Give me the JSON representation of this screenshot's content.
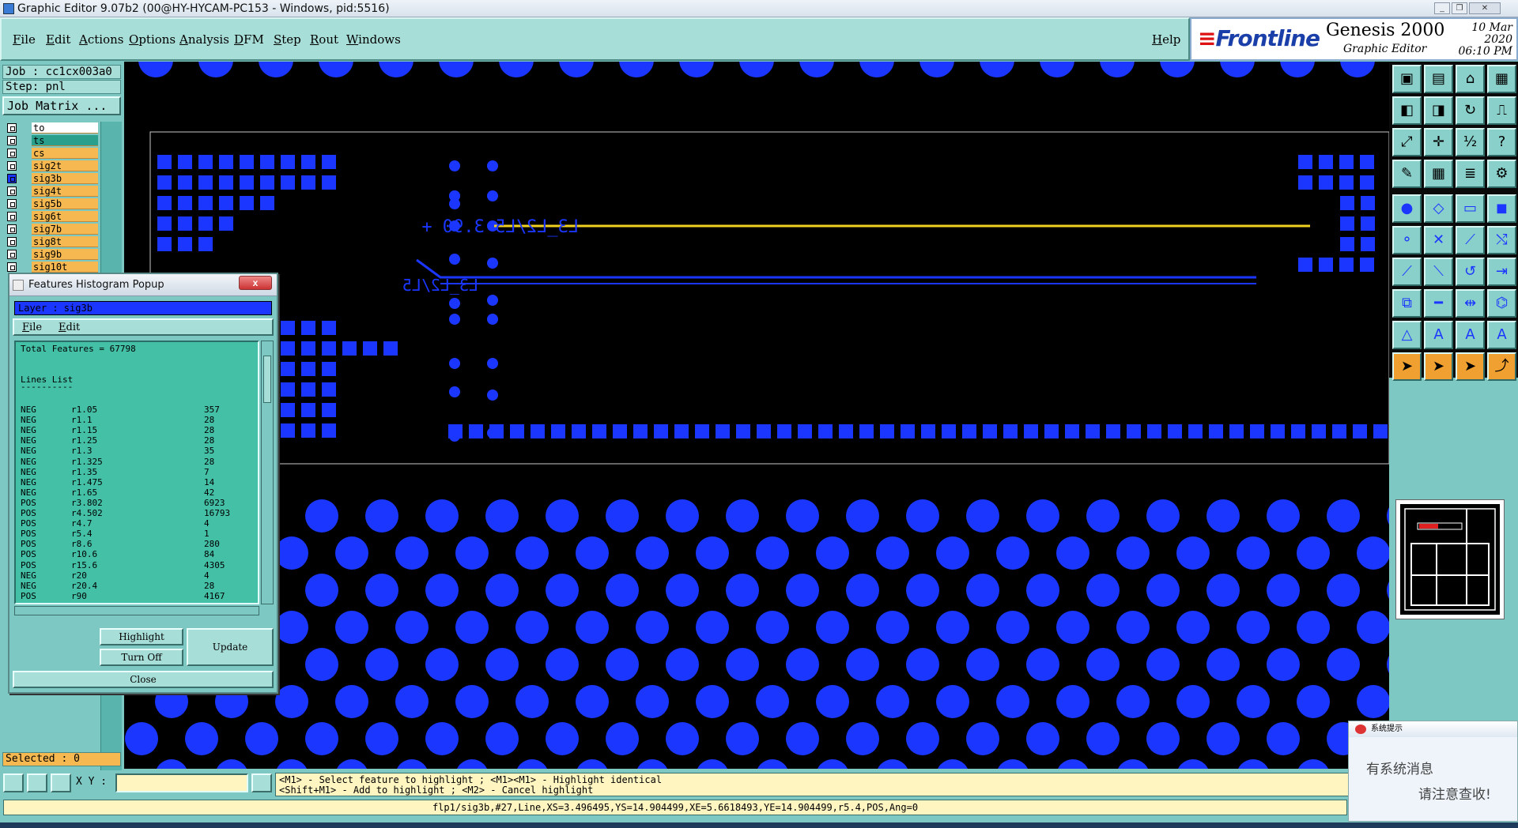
{
  "window": {
    "title": "Graphic Editor 9.07b2 (00@HY-HYCAM-PC153 - Windows, pid:5516)",
    "minimize": "_",
    "restore": "❐",
    "close": "✕"
  },
  "menu": {
    "items": [
      "File",
      "Edit",
      "Actions",
      "Options",
      "Analysis",
      "DFM",
      "Step",
      "Rout",
      "Windows"
    ],
    "help": "Help"
  },
  "brand": {
    "logo": "Frontline",
    "product": "Genesis 2000",
    "subtitle": "Graphic Editor",
    "date": "10 Mar 2020",
    "time": "06:10 PM"
  },
  "left": {
    "job": "Job : cc1cx003a0",
    "step": "Step: pnl",
    "job_matrix": "Job Matrix ...",
    "layers": [
      {
        "name": "to",
        "style": "white"
      },
      {
        "name": "ts",
        "style": "selected"
      },
      {
        "name": "cs",
        "style": "normal"
      },
      {
        "name": "sig2t",
        "style": "normal"
      },
      {
        "name": "sig3b",
        "style": "active"
      },
      {
        "name": "sig4t",
        "style": "normal"
      },
      {
        "name": "sig5b",
        "style": "normal"
      },
      {
        "name": "sig6t",
        "style": "normal"
      },
      {
        "name": "sig7b",
        "style": "normal"
      },
      {
        "name": "sig8t",
        "style": "normal"
      },
      {
        "name": "sig9b",
        "style": "normal"
      },
      {
        "name": "sig10t",
        "style": "normal"
      }
    ],
    "selected": "Selected : 0"
  },
  "canvas": {
    "label_top": "L3_L2/L5 3.90 +",
    "label_mid": "L3_L2/L5",
    "colors": {
      "background": "#000000",
      "pad": "#1a36ff",
      "trace_highlight": "#f0d020",
      "outline": "#c8c8c8"
    }
  },
  "popup": {
    "title": "Features Histogram Popup",
    "close": "x",
    "layer": "Layer :  sig3b",
    "menu": [
      "File",
      "Edit"
    ],
    "total": "Total Features = 67798",
    "section": "Lines List",
    "divider": "----------",
    "rows": [
      {
        "pol": "NEG",
        "sym": "r1.05",
        "count": "357"
      },
      {
        "pol": "NEG",
        "sym": "r1.1",
        "count": "28"
      },
      {
        "pol": "NEG",
        "sym": "r1.15",
        "count": "28"
      },
      {
        "pol": "NEG",
        "sym": "r1.25",
        "count": "28"
      },
      {
        "pol": "NEG",
        "sym": "r1.3",
        "count": "35"
      },
      {
        "pol": "NEG",
        "sym": "r1.325",
        "count": "28"
      },
      {
        "pol": "NEG",
        "sym": "r1.35",
        "count": "7"
      },
      {
        "pol": "NEG",
        "sym": "r1.475",
        "count": "14"
      },
      {
        "pol": "NEG",
        "sym": "r1.65",
        "count": "42"
      },
      {
        "pol": "POS",
        "sym": "r3.802",
        "count": "6923"
      },
      {
        "pol": "POS",
        "sym": "r4.502",
        "count": "16793"
      },
      {
        "pol": "POS",
        "sym": "r4.7",
        "count": "4"
      },
      {
        "pol": "POS",
        "sym": "r5.4",
        "count": "1"
      },
      {
        "pol": "POS",
        "sym": "r8.6",
        "count": "280"
      },
      {
        "pol": "POS",
        "sym": "r10.6",
        "count": "84"
      },
      {
        "pol": "POS",
        "sym": "r15.6",
        "count": "4305"
      },
      {
        "pol": "NEG",
        "sym": "r20",
        "count": "4"
      },
      {
        "pol": "NEG",
        "sym": "r20.4",
        "count": "28"
      },
      {
        "pol": "POS",
        "sym": "r90",
        "count": "4167"
      }
    ],
    "highlight": "Highlight",
    "turn_off": "Turn Off",
    "update": "Update",
    "close_btn": "Close"
  },
  "bottom": {
    "xy_label": "X Y :",
    "xy_value": "",
    "hint1": "<M1> - Select feature to highlight ; <M1><M1> - Highlight identical",
    "hint2": "<Shift+M1> - Add to highlight ; <M2> - Cancel highlight",
    "status": "flp1/sig3b,#27,Line,XS=3.496495,YS=14.904499,XE=5.6618493,YE=14.904499,r5.4,POS,Ang=0"
  },
  "notice": {
    "title": "系统提示",
    "line1": "有系统消息",
    "line2": "请注意查收!"
  },
  "tools": {
    "icons": [
      "zoom-home-icon",
      "zoom-out-icon",
      "home-icon",
      "window-icon",
      "pan-left-icon",
      "pan-right-icon",
      "redraw-icon",
      "snap-icon",
      "fit-icon",
      "center-icon",
      "scale-icon",
      "help-icon",
      "measure-icon",
      "grid-icon",
      "layers-icon",
      "filters-icon",
      "pad-icon",
      "line-icon",
      "ruler-icon",
      "surface-icon",
      "net-icon",
      "cross-icon",
      "connect-icon",
      "move-icon",
      "draw-line-icon",
      "diag-icon",
      "arc-icon",
      "split-icon",
      "copy-icon",
      "delete-icon",
      "resize-icon",
      "transform-icon",
      "polygon-icon",
      "text-a-icon",
      "text-b-icon",
      "text-c-icon",
      "select-icon",
      "select-box-icon",
      "select-net-icon",
      "route-icon"
    ]
  }
}
